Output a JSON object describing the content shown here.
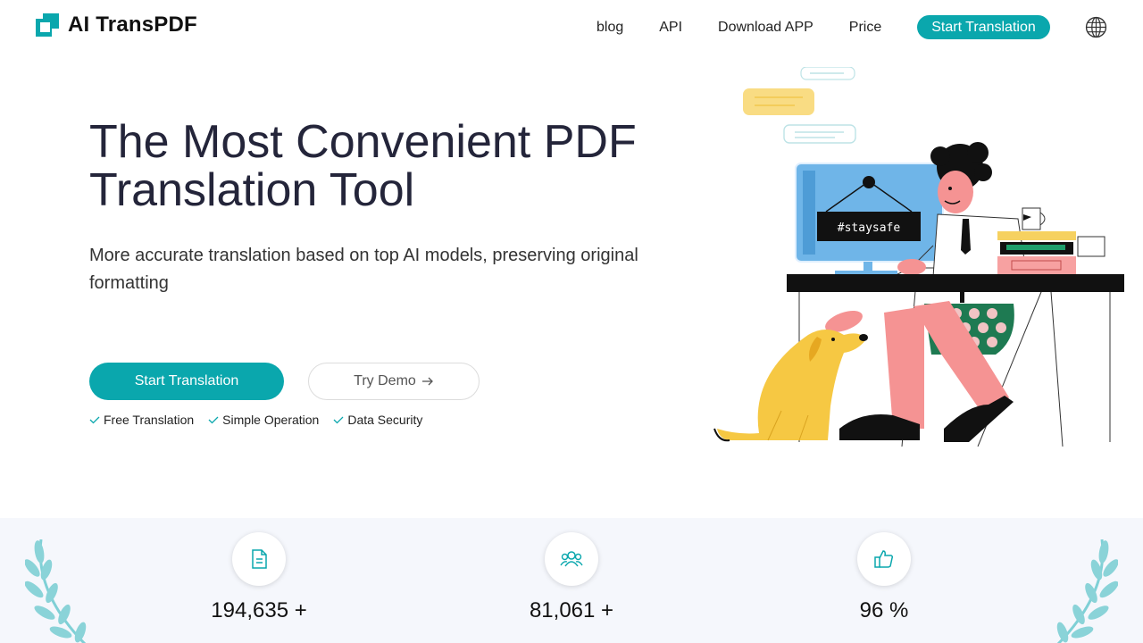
{
  "brand": {
    "name": "AI TransPDF",
    "accent": "#0aa7ad"
  },
  "nav": {
    "links": [
      "blog",
      "API",
      "Download APP",
      "Price"
    ],
    "cta": "Start Translation",
    "language_icon": "globe-icon"
  },
  "hero": {
    "title": "The Most Convenient PDF Translation Tool",
    "subtitle": "More accurate translation based on top AI models, preserving original formatting",
    "primary_button": "Start Translation",
    "secondary_button": "Try Demo",
    "secondary_icon": "arrow-right-icon",
    "features": [
      "Free Translation",
      "Simple Operation",
      "Data Security"
    ]
  },
  "illustration": {
    "sign_text": "#staysafe"
  },
  "stats": [
    {
      "icon": "document-icon",
      "value": "194,635 +"
    },
    {
      "icon": "users-icon",
      "value": "81,061 +"
    },
    {
      "icon": "thumbs-up-icon",
      "value": "96 %"
    }
  ]
}
